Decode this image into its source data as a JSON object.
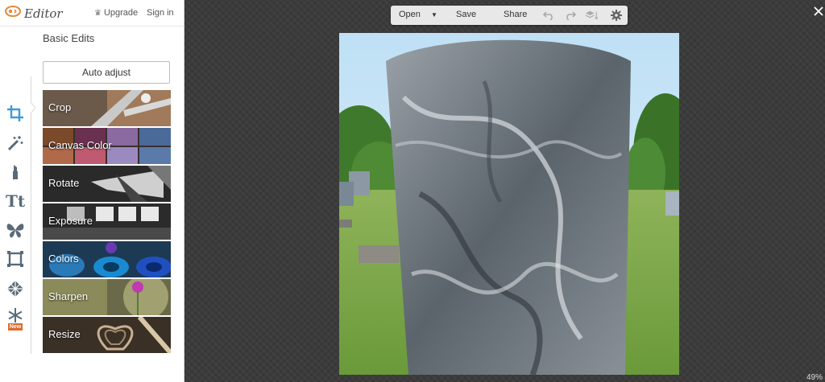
{
  "app": {
    "logo_text": "Editor",
    "upgrade_label": "Upgrade",
    "signin_label": "Sign in"
  },
  "panel": {
    "section_title": "Basic Edits",
    "auto_adjust_label": "Auto adjust",
    "tools": [
      {
        "name": "crop-tool-icon",
        "active": true
      },
      {
        "name": "magic-wand-icon"
      },
      {
        "name": "lipstick-icon"
      },
      {
        "name": "text-icon",
        "glyph": "Tt"
      },
      {
        "name": "butterfly-icon"
      },
      {
        "name": "frame-icon"
      },
      {
        "name": "texture-icon"
      },
      {
        "name": "snowflake-icon",
        "badge": "New"
      }
    ],
    "edits": [
      {
        "label": "Crop"
      },
      {
        "label": "Canvas Color"
      },
      {
        "label": "Rotate"
      },
      {
        "label": "Exposure"
      },
      {
        "label": "Colors"
      },
      {
        "label": "Sharpen"
      },
      {
        "label": "Resize"
      }
    ]
  },
  "toolbar": {
    "open_label": "Open",
    "save_label": "Save",
    "share_label": "Share",
    "icons": [
      "undo-icon",
      "redo-icon",
      "layers-icon",
      "settings-icon"
    ]
  },
  "canvas": {
    "zoom_label": "49%"
  },
  "colors": {
    "accent": "#3d9bd6",
    "canvas_bg": "#3b3b3b",
    "badge": "#e06a2c"
  }
}
